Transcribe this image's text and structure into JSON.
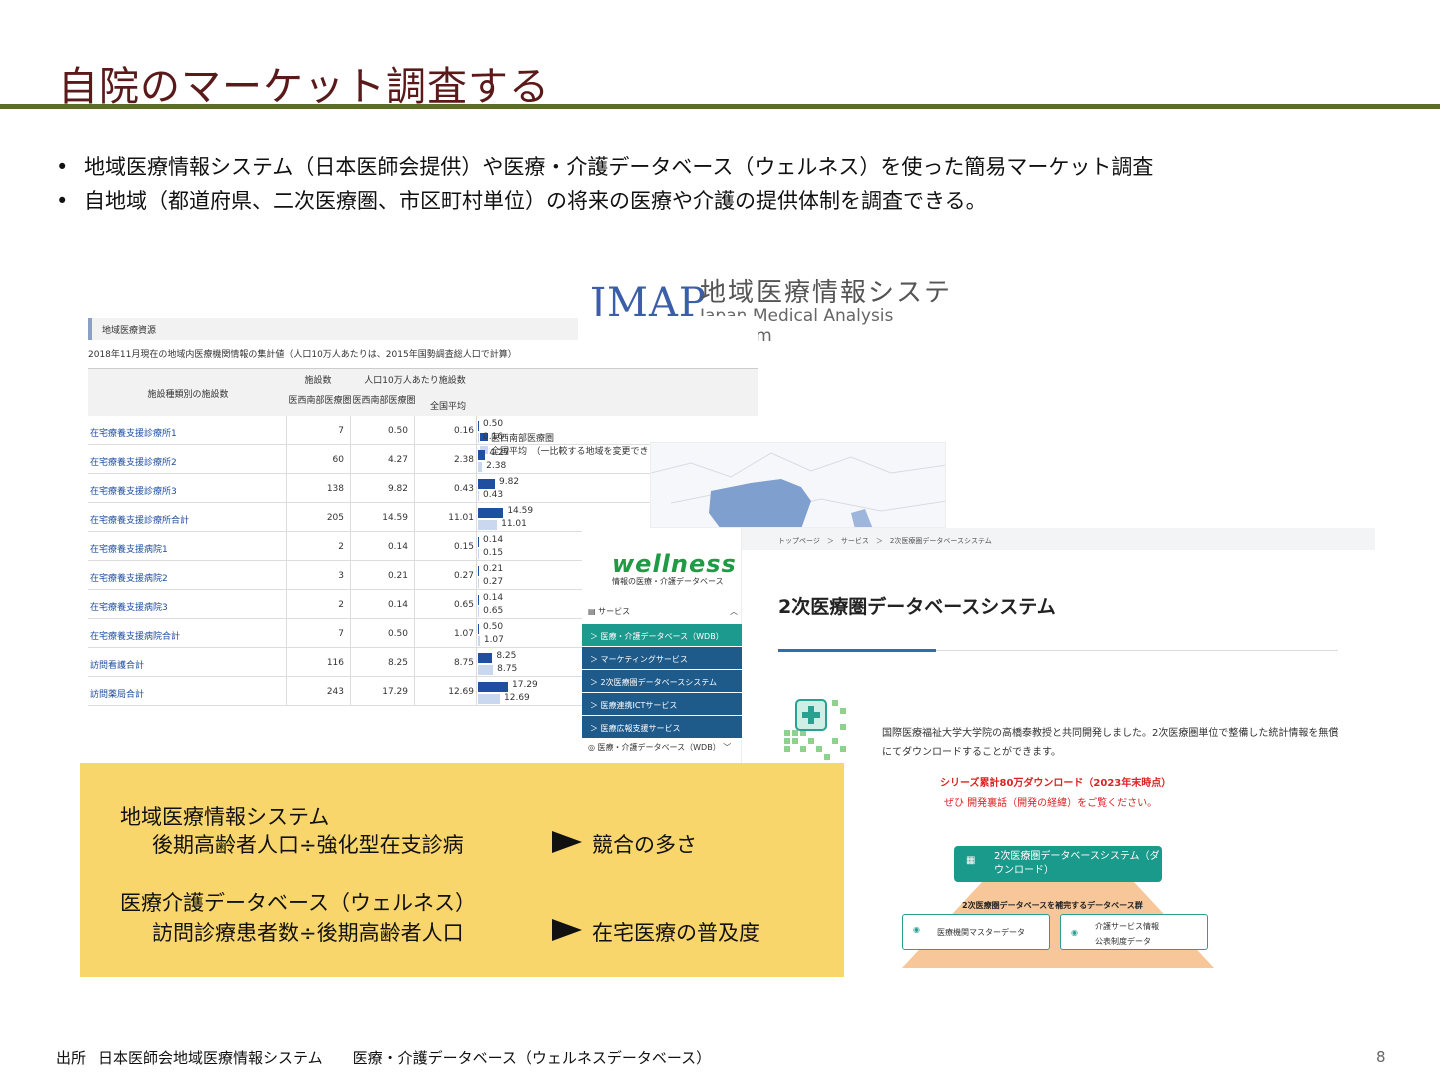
{
  "title": "自院のマーケット調査する",
  "bullets": [
    "地域医療情報システム（日本医師会提供）や医療・介護データベース（ウェルネス）を使った簡易マーケット調査",
    "自地域（都道府県、二次医療圏、市区町村単位）の将来の医療や介護の提供体制を調査できる。"
  ],
  "jmap": {
    "mark": "JMAP",
    "jp": "地域医療情報システム",
    "en": "Japan Medical Analysis Platform"
  },
  "jmap_table": {
    "section": "地域医療資源",
    "note": "2018年11月現在の地域内医療機関情報の集計値（人口10万人あたりは、2015年国勢調査総人口で計算）",
    "col_category": "施設種類別の施設数",
    "col_count": "施設数",
    "col_per": "人口10万人あたり施設数",
    "col_region": "医西南部医療圏",
    "col_region2": "医西南部医療圏",
    "col_national": "全国平均",
    "legend_region": "医西南部医療圏",
    "legend_national": "全国平均　（一比較する地域を変更できます）",
    "rows": [
      {
        "name": "在宅療養支援診療所1",
        "count": "7",
        "region": "0.50",
        "national": "0.16",
        "a": 0.5,
        "b": 0.16,
        "la": "0.50",
        "lb": "0.16"
      },
      {
        "name": "在宅療養支援診療所2",
        "count": "60",
        "region": "4.27",
        "national": "2.38",
        "a": 4.27,
        "b": 2.38,
        "la": "4.27",
        "lb": "2.38"
      },
      {
        "name": "在宅療養支援診療所3",
        "count": "138",
        "region": "9.82",
        "national": "0.43",
        "a": 9.82,
        "b": 0.43,
        "la": "9.82",
        "lb": "0.43"
      },
      {
        "name": "在宅療養支援診療所合計",
        "count": "205",
        "region": "14.59",
        "national": "11.01",
        "a": 14.59,
        "b": 11.01,
        "la": "14.59",
        "lb": "11.01"
      },
      {
        "name": "在宅療養支援病院1",
        "count": "2",
        "region": "0.14",
        "national": "0.15",
        "a": 0.14,
        "b": 0.15,
        "la": "0.14",
        "lb": "0.15"
      },
      {
        "name": "在宅療養支援病院2",
        "count": "3",
        "region": "0.21",
        "national": "0.27",
        "a": 0.21,
        "b": 0.27,
        "la": "0.21",
        "lb": "0.27"
      },
      {
        "name": "在宅療養支援病院3",
        "count": "2",
        "region": "0.14",
        "national": "0.65",
        "a": 0.14,
        "b": 0.65,
        "la": "0.14",
        "lb": "0.65"
      },
      {
        "name": "在宅療養支援病院合計",
        "count": "7",
        "region": "0.50",
        "national": "1.07",
        "a": 0.5,
        "b": 1.07,
        "la": "0.50",
        "lb": "1.07"
      },
      {
        "name": "訪問看護合計",
        "count": "116",
        "region": "8.25",
        "national": "8.75",
        "a": 8.25,
        "b": 8.75,
        "la": "8.25",
        "lb": "8.75"
      },
      {
        "name": "訪問薬局合計",
        "count": "243",
        "region": "17.29",
        "national": "12.69",
        "a": 17.29,
        "b": 12.69,
        "la": "17.29",
        "lb": "12.69"
      }
    ]
  },
  "wellness": {
    "logo": "wellness",
    "logo_sub": "情報の医療・介護データベース",
    "crumb": "トップページ　＞　サービス　＞　2次医療圏データベースシステム",
    "services_label": "サービス",
    "menu": [
      "＞ 医療・介護データベース（WDB）",
      "＞ マーケティングサービス",
      "＞ 2次医療圏データベースシステム",
      "＞ 医療連携ICTサービス",
      "＞ 医療広報支援サービス"
    ],
    "side_foot": "医療・介護データベース（WDB）",
    "page_title": "2次医療圏データベースシステム",
    "desc": "国際医療福祉大学大学院の高橋泰教授と共同開発しました。2次医療圏単位で整備した統計情報を無償にてダウンロードすることができます。",
    "red1": "シリーズ累計80万ダウンロード（2023年末時点）",
    "red2": "ぜひ 開発裏話（開発の経緯）をご覧ください。",
    "dl_button": "2次医療圏データベースシステム（ダウンロード）",
    "trap_label": "2次医療圏データベースを補完するデータベース群",
    "box1": "医療機関マスターデータ",
    "box2a": "介護サービス情報",
    "box2b": "公表制度データ"
  },
  "yellow": {
    "l1": "地域医療情報システム",
    "l2": "後期高齢者人口÷強化型在支診病",
    "r1": "競合の多さ",
    "l3": "医療介護データベース（ウェルネス）",
    "l4": "訪問診療患者数÷後期高齢者人口",
    "r2": "在宅医療の普及度"
  },
  "source": {
    "label": "出所",
    "s1": "日本医師会地域医療情報システム",
    "s2": "医療・介護データベース（ウェルネスデータベース）"
  },
  "page_number": "8"
}
